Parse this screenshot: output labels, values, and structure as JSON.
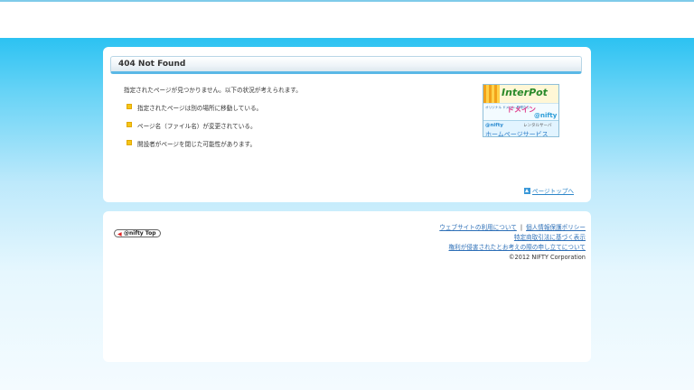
{
  "page": {
    "title": "404 Not Found",
    "lead": "指定されたページが見つかりません。以下の状況が考えられます。",
    "reasons": [
      "指定されたページは別の場所に移動している。",
      "ページ名（ファイル名）が変更されている。",
      "開設者がページを閉じた可能性があります。"
    ],
    "page_top": "ページトップへ"
  },
  "banner": {
    "brand": "InterPot",
    "small_text": "オリジナル ドメイン 取得なら",
    "domain": "ドメイン",
    "nifty": "@nifty",
    "rental": "レンタルサーバ",
    "hp_service": "ホームページサービス"
  },
  "footer": {
    "nifty_top": "@nifty Top",
    "links": [
      "ウェブサイトの利用について",
      "個人情報保護ポリシー",
      "特定商取引法に基づく表示",
      "権利が侵害されたとお考えの際の申し立てについて"
    ],
    "separator": "|",
    "copyright": "©2012 NIFTY Corporation"
  },
  "colors": {
    "accent": "#5ab8e6",
    "link": "#2d6fb7",
    "bullet": "#f5c518"
  }
}
